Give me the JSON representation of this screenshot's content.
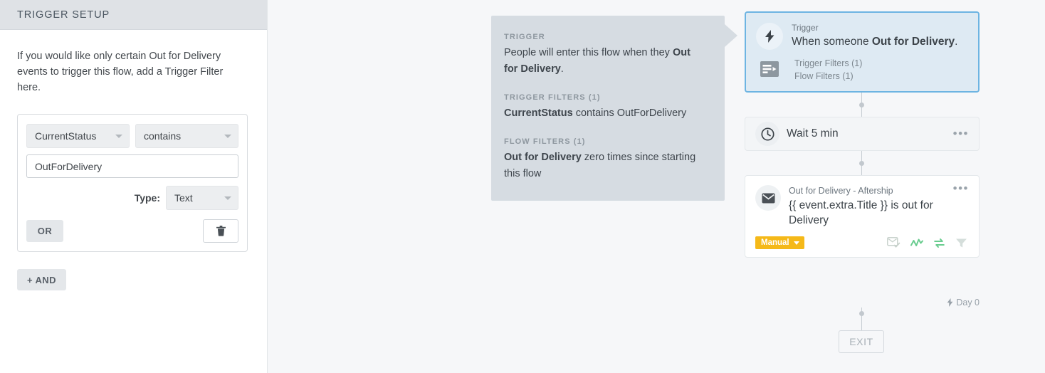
{
  "sidebar": {
    "header_title": "TRIGGER SETUP",
    "helper_text": "If you would like only certain Out for Delivery events to trigger this flow, add a Trigger Filter here.",
    "filter": {
      "attribute_value": "CurrentStatus",
      "operator_value": "contains",
      "input_value": "OutForDelivery",
      "type_label": "Type:",
      "type_value": "Text",
      "or_label": "OR",
      "delete_icon": "trash-icon"
    },
    "and_label": "+ AND"
  },
  "summary": {
    "trigger_label": "TRIGGER",
    "trigger_text_1": "People will enter this flow when they ",
    "trigger_text_bold": "Out for Delivery",
    "trigger_text_2": ".",
    "trigger_filters_label": "TRIGGER FILTERS (1)",
    "trigger_filters_bold": "CurrentStatus",
    "trigger_filters_rest": " contains OutForDelivery",
    "flow_filters_label": "FLOW FILTERS (1)",
    "flow_filters_bold": "Out for Delivery",
    "flow_filters_rest": " zero times since starting this flow"
  },
  "flow": {
    "trigger_card": {
      "icon": "lightning-bolt-icon",
      "eyebrow": "Trigger",
      "title_prefix": "When someone ",
      "title_bold": "Out for Delivery",
      "title_suffix": ".",
      "filters_icon": "filter-list-icon",
      "trigger_filters": "Trigger Filters (1)",
      "flow_filters": "Flow Filters (1)"
    },
    "wait_card": {
      "icon": "clock-icon",
      "label": "Wait 5 min",
      "menu_icon": "ellipsis-icon"
    },
    "email_card": {
      "icon": "envelope-icon",
      "eyebrow": "Out for Delivery - Aftership",
      "subject": "{{ event.extra.Title }} is out for Delivery",
      "menu_icon": "ellipsis-icon",
      "badge_label": "Manual",
      "status_icons": [
        "email-check-icon",
        "analytics-icon",
        "smart-sending-icon",
        "filter-icon"
      ]
    },
    "day_label": "Day 0",
    "day_icon": "lightning-bolt-icon",
    "exit_label": "EXIT"
  },
  "colors": {
    "trigger_border": "#6db4e2",
    "trigger_bg": "#deeaf3",
    "badge_yellow": "#f5b919",
    "status_green": "#69cc8f",
    "summary_bg": "#d6dce2",
    "canvas_bg": "#f6f7f9"
  }
}
